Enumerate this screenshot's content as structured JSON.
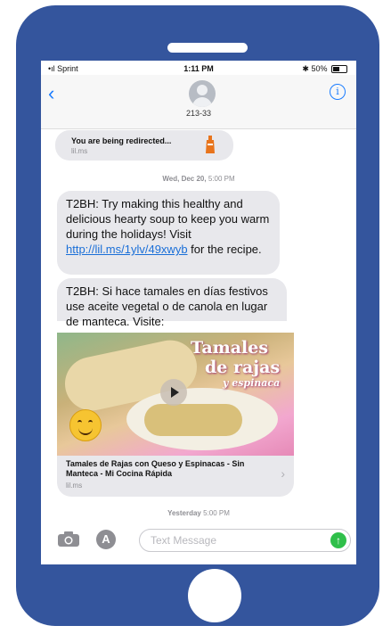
{
  "status_bar": {
    "carrier": "•ıl Sprint",
    "time": "1:11 PM",
    "battery": "50%",
    "bluetooth_glyph": "✱"
  },
  "header": {
    "back_glyph": "‹",
    "contact": "213-33",
    "info_glyph": "i"
  },
  "messages": {
    "redirect_title": "You are being redirected...",
    "redirect_source": "lil.ms",
    "timestamp1_day": "Wed, Dec 20,",
    "timestamp1_time": "5:00 PM",
    "msg1_text": "T2BH: Try making this healthy and delicious hearty soup to keep you warm during the holidays! Visit ",
    "msg1_link": "http://lil.ms/1ylv/49xwyb",
    "msg1_tail": " for the recipe.",
    "msg2_text": "T2BH: Si hace tamales en días festivos use aceite vegetal o de canola en lugar de manteca. Visite:",
    "card_overlay_1": "Tamales",
    "card_overlay_2": "de rajas",
    "card_overlay_3": "y espinaca",
    "card_title": "Tamales de Rajas con Queso y Espinacas - Sin Manteca - Mi Cocina Rápida",
    "card_source": "lil.ms",
    "card_chevron": "›",
    "timestamp2_day": "Yesterday",
    "timestamp2_time": "5:00 PM"
  },
  "input_bar": {
    "placeholder": "Text Message",
    "appstore_glyph": "A",
    "send_glyph": "↑"
  },
  "colors": {
    "phone_frame": "#34559d",
    "ios_blue": "#1a7cff",
    "bubble_gray": "#e8e8ec",
    "send_green": "#2fbf4a"
  }
}
